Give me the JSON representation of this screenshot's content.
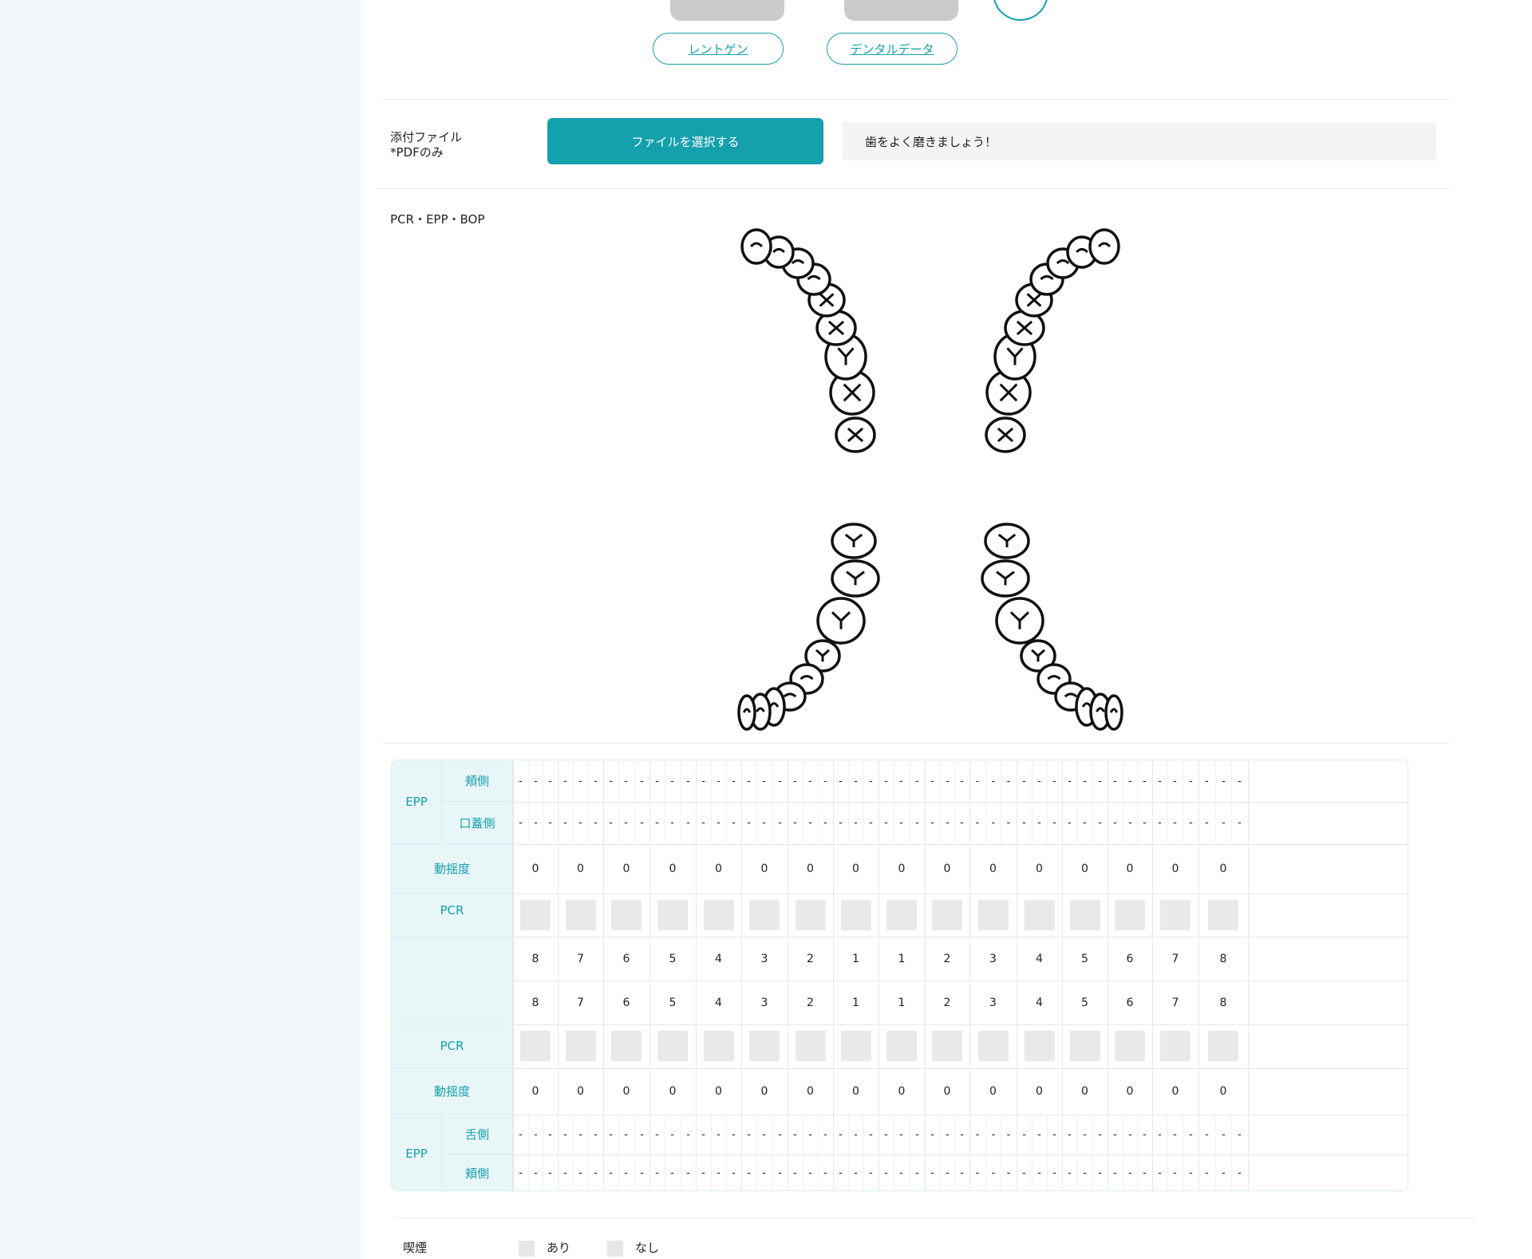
{
  "images": {
    "xray_label": "レントゲン",
    "dental_data_label": "デンタルデータ"
  },
  "attachment": {
    "label": "添付ファイル",
    "sublabel": "*PDFのみ",
    "button": "ファイルを選択する",
    "memo": "歯をよく磨きましょう！"
  },
  "section": {
    "title": "PCR・EPP・BOP"
  },
  "chart": {
    "labels": {
      "epp": "EPP",
      "buccal": "頬側",
      "palatal": "口蓋側",
      "lingual": "舌側",
      "mobility": "動揺度",
      "pcr": "PCR"
    },
    "upper_teeth": [
      "8",
      "7",
      "6",
      "5",
      "4",
      "3",
      "2",
      "1",
      "1",
      "2",
      "3",
      "4",
      "5",
      "6",
      "7",
      "8"
    ],
    "lower_teeth": [
      "8",
      "7",
      "6",
      "5",
      "4",
      "3",
      "2",
      "1",
      "1",
      "2",
      "3",
      "4",
      "5",
      "6",
      "7",
      "8"
    ],
    "upper_mobility": [
      "0",
      "0",
      "0",
      "0",
      "0",
      "0",
      "0",
      "0",
      "0",
      "0",
      "0",
      "0",
      "0",
      "0",
      "0",
      "0"
    ],
    "lower_mobility": [
      "0",
      "0",
      "0",
      "0",
      "0",
      "0",
      "0",
      "0",
      "0",
      "0",
      "0",
      "0",
      "0",
      "0",
      "0",
      "0"
    ],
    "epp_value": "-"
  },
  "smoking": {
    "label": "喫煙",
    "yes": "あり",
    "no": "なし"
  },
  "colors": {
    "accent": "#14a0ad",
    "sidebar": "#f3f7fa",
    "label_bg": "#e9f6f8"
  }
}
